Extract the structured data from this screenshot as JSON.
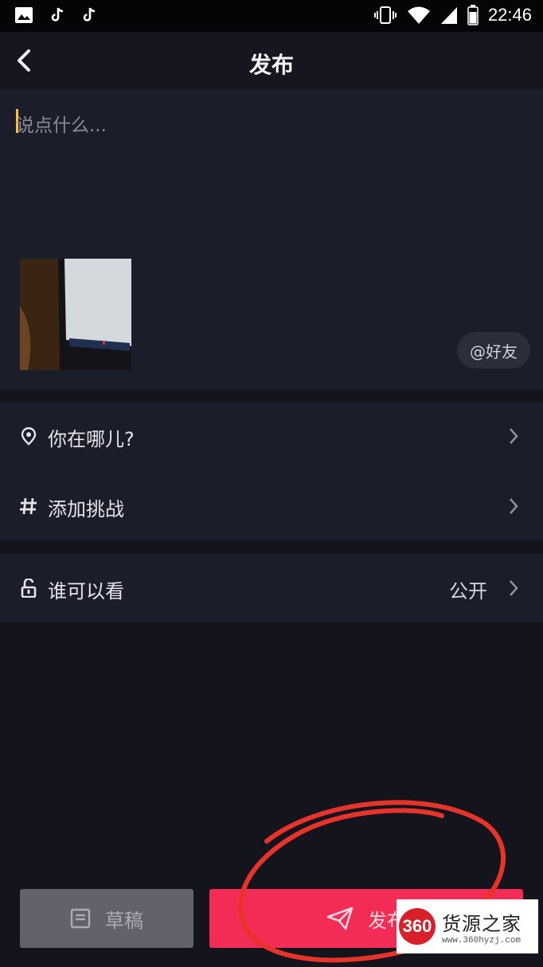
{
  "status_bar": {
    "time": "22:46",
    "left_icons": [
      "image-icon",
      "tiktok-icon",
      "tiktok-icon"
    ],
    "right_icons": [
      "vibrate-icon",
      "wifi-icon",
      "signal-icon",
      "battery-icon"
    ]
  },
  "header": {
    "title": "发布",
    "back_icon": "chevron-left-icon"
  },
  "compose": {
    "placeholder": "说点什么...",
    "mention_label": "@好友"
  },
  "options": [
    {
      "icon": "location-pin-icon",
      "label": "你在哪儿?",
      "value": ""
    },
    {
      "icon": "hashtag-icon",
      "label": "添加挑战",
      "value": ""
    },
    {
      "icon": "unlock-icon",
      "label": "谁可以看",
      "value": "公开"
    }
  ],
  "actions": {
    "draft_label": "草稿",
    "publish_label": "发布"
  },
  "watermark": {
    "logo_text": "360",
    "name": "货源之家",
    "url": "www.360hyzj.com"
  },
  "colors": {
    "background": "#13141c",
    "panel": "#1c1d2a",
    "publish_button": "#f32c55",
    "draft_button": "#62626b",
    "caret": "#f7c33a"
  }
}
